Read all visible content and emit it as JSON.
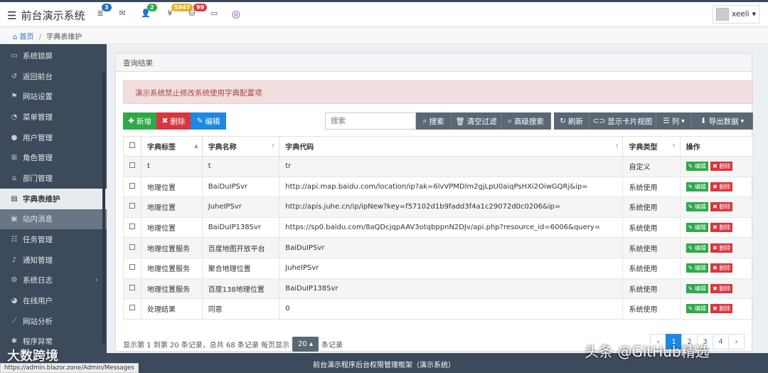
{
  "app": {
    "title": "前台演示系统"
  },
  "topbar": {
    "icons": [
      {
        "name": "app-icon",
        "badge": "3",
        "badge_color": "#1e73be"
      },
      {
        "name": "mail-icon",
        "badge": "",
        "badge_color": ""
      },
      {
        "name": "user-plus-icon",
        "badge": "2",
        "badge_color": "#2fa84a"
      },
      {
        "name": "money-icon",
        "badge": "5947",
        "badge_color": "#e6b322"
      },
      {
        "name": "database-icon",
        "badge": "99",
        "badge_color": "#d9363e"
      },
      {
        "name": "monitor-icon",
        "badge": "",
        "badge_color": ""
      },
      {
        "name": "blazor-logo-icon",
        "badge": "",
        "badge_color": ""
      }
    ],
    "username": "xeeli"
  },
  "breadcrumb": {
    "home": "首页",
    "current": "字典表维护"
  },
  "sidebar": {
    "items": [
      {
        "label": "系统锁屏",
        "icon": "monitor-icon"
      },
      {
        "label": "返回前台",
        "icon": "return-icon"
      },
      {
        "label": "网站设置",
        "icon": "flag-icon"
      },
      {
        "label": "菜单管理",
        "icon": "dashboard-icon"
      },
      {
        "label": "用户管理",
        "icon": "user-icon"
      },
      {
        "label": "角色管理",
        "icon": "sitemap-icon"
      },
      {
        "label": "部门管理",
        "icon": "bank-icon"
      },
      {
        "label": "字典表维护",
        "icon": "book-icon"
      },
      {
        "label": "站内消息",
        "icon": "message-icon"
      },
      {
        "label": "任务管理",
        "icon": "tasks-icon"
      },
      {
        "label": "通知管理",
        "icon": "bell-icon"
      },
      {
        "label": "系统日志",
        "icon": "gears-icon"
      },
      {
        "label": "在线用户",
        "icon": "users-icon"
      },
      {
        "label": "网站分析",
        "icon": "chart-icon"
      },
      {
        "label": "程序异常",
        "icon": "bug-icon"
      }
    ]
  },
  "panel": {
    "title": "查询结果"
  },
  "alert": {
    "text": "演示系统禁止修改系统使用字典配置项"
  },
  "toolbar": {
    "add": "新增",
    "delete": "删除",
    "edit": "编辑",
    "search_placeholder": "搜索",
    "search": "搜索",
    "clear": "清空过滤",
    "advanced": "高级搜索",
    "refresh": "刷新",
    "card_view": "显示卡片视图",
    "columns": "列",
    "export": "导出数据"
  },
  "table": {
    "headers": [
      "字典标签",
      "字典名称",
      "字典代码",
      "字典类型",
      "操作"
    ],
    "edit_label": "编辑",
    "delete_label": "删除",
    "rows": [
      [
        "t",
        "t",
        "tr",
        "自定义"
      ],
      [
        "地理位置",
        "BaiDuIPSvr",
        "http://api.map.baidu.com/location/ip?ak=6lvVPMDlm2gjLpU0aiqPsHXi2OiwGQRj&ip=",
        "系统使用"
      ],
      [
        "地理位置",
        "JuheIPSvr",
        "http://apis.juhe.cn/ip/ipNew?key=f57102d1b9fadd3f4a1c29072d0c0206&ip=",
        "系统使用"
      ],
      [
        "地理位置",
        "BaiDuIP138Svr",
        "https://sp0.baidu.com/8aQDcjqpAAV3otqbppnN2DJv/api.php?resource_id=6006&query=",
        "系统使用"
      ],
      [
        "地理位置服务",
        "百度地图开放平台",
        "BaiDuIPSvr",
        "系统使用"
      ],
      [
        "地理位置服务",
        "聚合地理位置",
        "JuheIPSvr",
        "系统使用"
      ],
      [
        "地理位置服务",
        "百度138地理位置",
        "BaiDuIP138Svr",
        "系统使用"
      ],
      [
        "处理结果",
        "同意",
        "0",
        "系统使用"
      ]
    ]
  },
  "pagination": {
    "info": "显示第 1 到第 20 条记录，总共 68 条记录 每页显示",
    "page_size": "20",
    "suffix": "条记录",
    "prev": "‹",
    "pages": [
      "1",
      "2",
      "3",
      "4"
    ],
    "next": "›",
    "current": "1"
  },
  "footer": {
    "text": "前台演示程序后台权限管理框架（演示系统）"
  },
  "statusbar": {
    "url": "https://admin.blazor.zone/Admin/Messages"
  },
  "watermarks": {
    "left": "大数跨境",
    "right": "头条 @GitHub精选"
  }
}
